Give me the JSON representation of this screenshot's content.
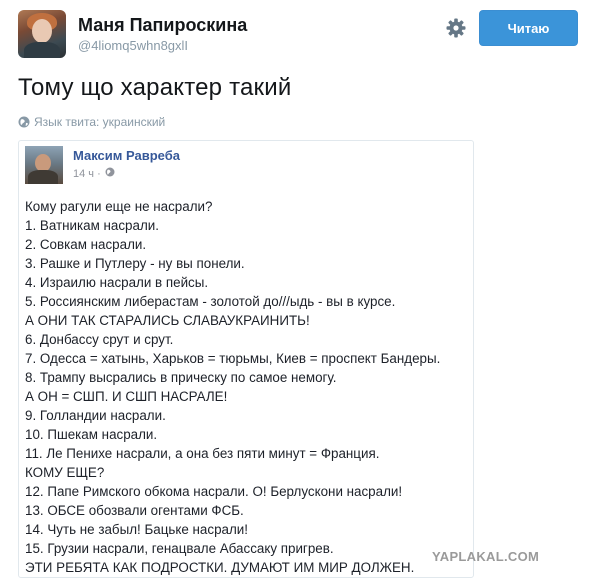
{
  "profile": {
    "name": "Маня Папироскина",
    "handle": "@4liomq5whn8gxlI"
  },
  "actions": {
    "follow_label": "Читаю",
    "settings_icon": "gear-icon"
  },
  "tweet": {
    "text": "Тому що характер такий",
    "language_label": "Язык твита: украинский"
  },
  "embedded_post": {
    "author": "Максим Равреба",
    "time": "14 ч ·",
    "lines": [
      "Кому рагули еще не насрали?",
      "1. Ватникам насрали.",
      "2. Совкам насрали.",
      "3. Рашке и Путлеру - ну вы понели.",
      "4. Израилю насрали в пейсы.",
      "5. Россиянским либерастам - золотой до///ыдь - вы в курсе.",
      "А ОНИ ТАК СТАРАЛИСЬ СЛАВАУКРАИНИТЬ!",
      "6. Донбассу срут и срут.",
      "7. Одесса = хатынь, Харьков = тюрьмы, Киев = проспект Бандеры.",
      "8. Трампу высрались в прическу по самое немогу.",
      "А ОН = СШП. И СШП НАСРАЛЕ!",
      "9. Голландии насрали.",
      "10. Пшекам насрали.",
      "11. Ле Пенихе насрали, а она без пяти минут = Франция.",
      "КОМУ ЕЩЕ?",
      "12. Папе Римского обкома насрали. О! Берлускони насрали!",
      "13. ОБСЕ обозвали огентами ФСБ.",
      "14. Чуть не забыл! Бацьке насрали!",
      "15. Грузии насрали, генацвале Абассаку пригрев.",
      "ЭТИ РЕБЯТА КАК ПОДРОСТКИ. ДУМАЮТ ИМ МИР ДОЛЖЕН."
    ]
  },
  "watermark": "YAPLAKAL.COM"
}
